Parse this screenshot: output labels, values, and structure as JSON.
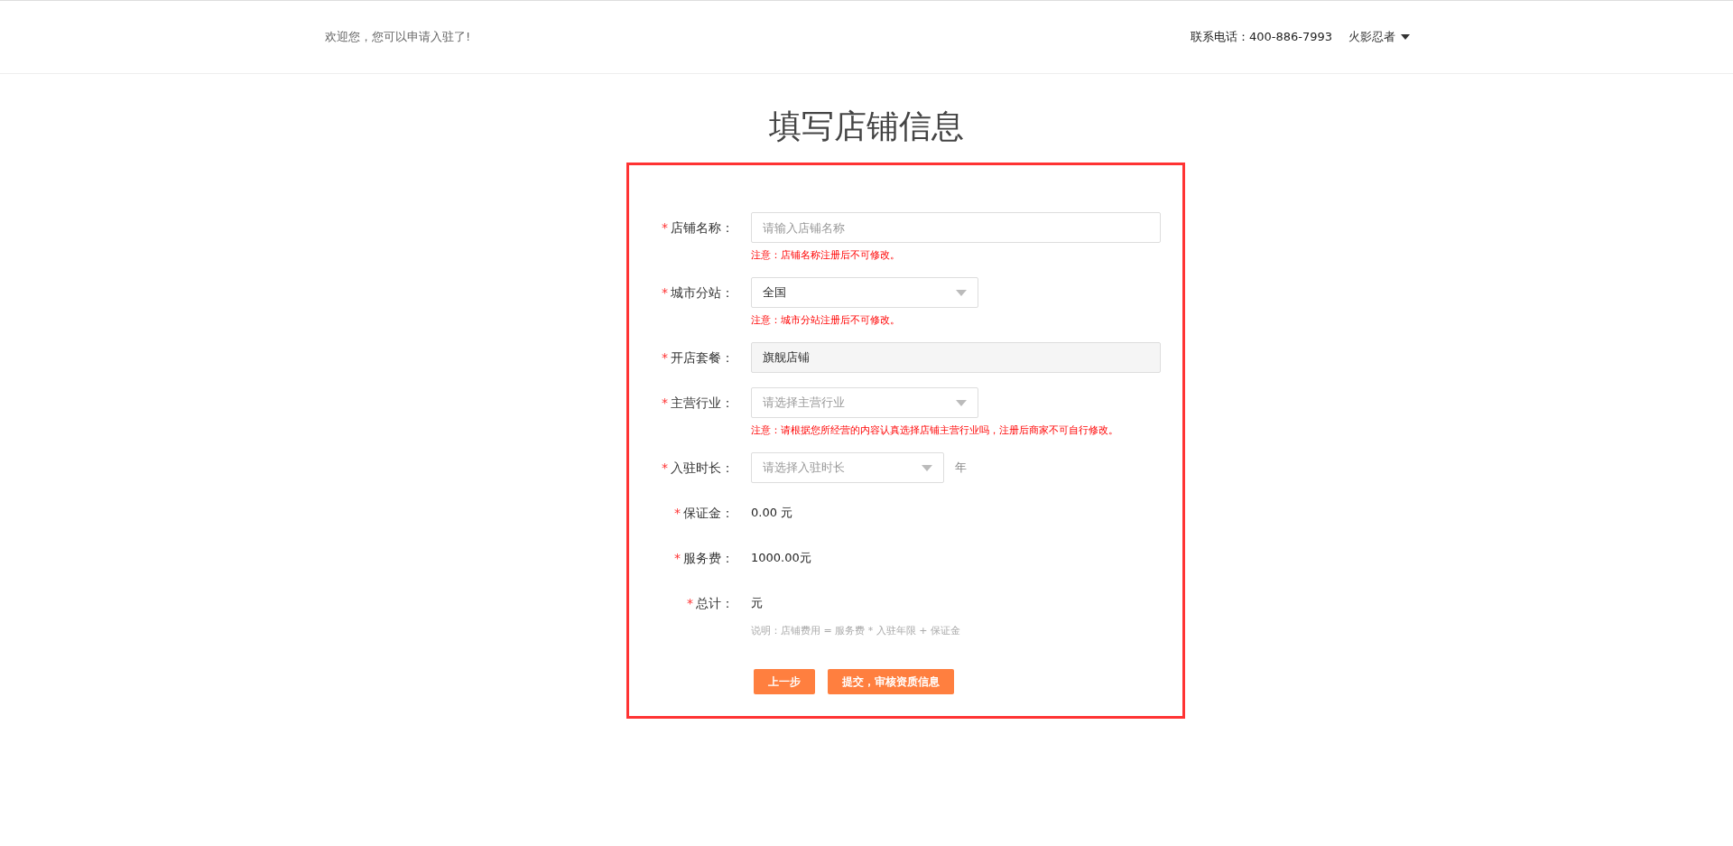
{
  "header": {
    "welcome": "欢迎您，您可以申请入驻了!",
    "phone": "联系电话：400-886-7993",
    "user": "火影忍者"
  },
  "title": "填写店铺信息",
  "fields": [
    {
      "kind": "input",
      "mark": "*",
      "label": "店铺名称：",
      "placeholder": "请输入店铺名称",
      "note": "注意：店铺名称注册后不可修改。"
    },
    {
      "kind": "select",
      "mark": "*",
      "label": "城市分站：",
      "value": "全国",
      "note": "注意：城市分站注册后不可修改。"
    },
    {
      "kind": "readonly",
      "mark": "*",
      "label": "开店套餐：",
      "value": "旗舰店铺"
    },
    {
      "kind": "select",
      "mark": "*",
      "label": "主营行业：",
      "placeholder": "请选择主营行业",
      "note": "注意：请根据您所经营的内容认真选择店铺主营行业吗，注册后商家不可自行修改。"
    },
    {
      "kind": "select_short",
      "mark": "*",
      "label": "入驻时长：",
      "placeholder": "请选择入驻时长",
      "unit": "年"
    },
    {
      "kind": "static",
      "mark": "*",
      "label": "保证金：",
      "value": "0.00 元"
    },
    {
      "kind": "static",
      "mark": "*",
      "label": "服务费：",
      "value": "1000.00元"
    },
    {
      "kind": "static",
      "mark": "*",
      "label": "总计：",
      "value": "元",
      "hint": "说明：店铺费用 = 服务费 * 入驻年限 + 保证金"
    }
  ],
  "buttons": [
    {
      "label": "上一步"
    },
    {
      "label": "提交，审核资质信息"
    }
  ]
}
